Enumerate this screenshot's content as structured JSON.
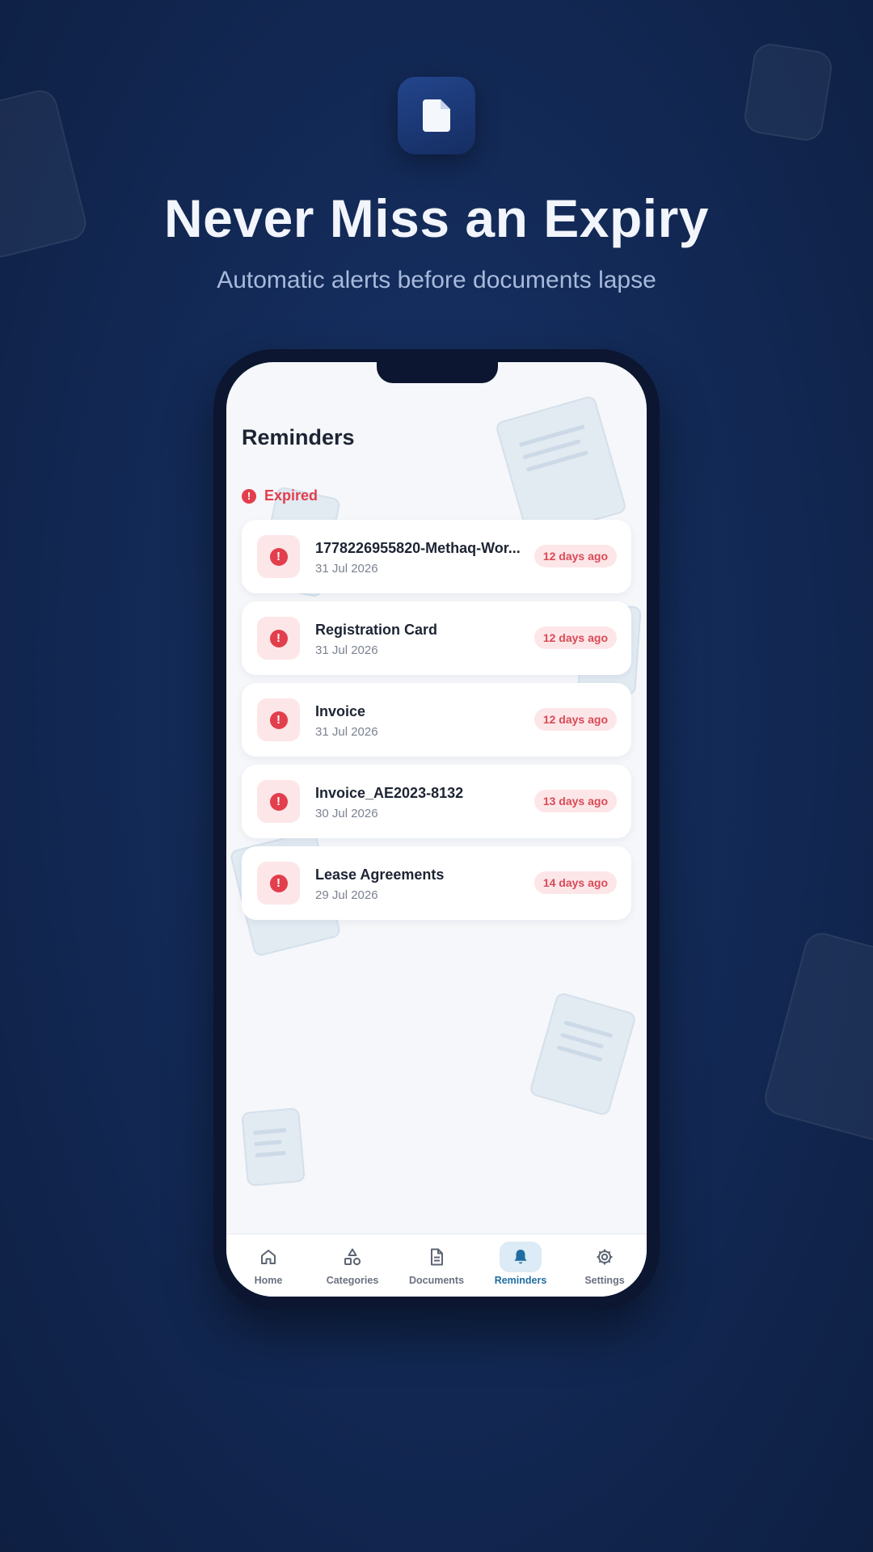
{
  "promo": {
    "headline": "Never Miss an Expiry",
    "subheadline": "Automatic alerts before documents lapse",
    "app_icon": "document-icon"
  },
  "screen": {
    "title": "Reminders",
    "section": {
      "label": "Expired",
      "icon": "alert-circle-icon",
      "accent_color": "#e23e4c"
    },
    "reminders": [
      {
        "title": "1778226955820-Methaq-Wor...",
        "date": "31 Jul 2026",
        "badge": "12 days ago"
      },
      {
        "title": "Registration Card",
        "date": "31 Jul 2026",
        "badge": "12 days ago"
      },
      {
        "title": "Invoice",
        "date": "31 Jul 2026",
        "badge": "12 days ago"
      },
      {
        "title": "Invoice_AE2023-8132",
        "date": "30 Jul 2026",
        "badge": "13 days ago"
      },
      {
        "title": "Lease Agreements",
        "date": "29 Jul 2026",
        "badge": "14 days ago"
      }
    ]
  },
  "nav": {
    "items": [
      {
        "label": "Home",
        "icon": "home-icon"
      },
      {
        "label": "Categories",
        "icon": "shapes-icon"
      },
      {
        "label": "Documents",
        "icon": "document-icon"
      },
      {
        "label": "Reminders",
        "icon": "bell-icon",
        "active": true
      },
      {
        "label": "Settings",
        "icon": "gear-icon"
      }
    ],
    "active_color": "#1f6da0"
  }
}
